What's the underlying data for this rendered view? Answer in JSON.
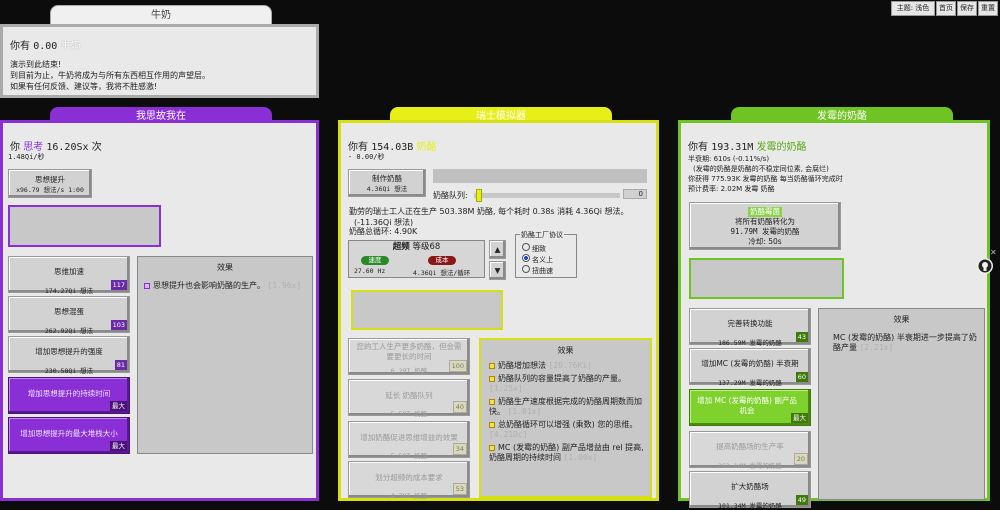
{
  "toolbar": {
    "theme": "主题: 浅色",
    "home": "首页",
    "save": "保存",
    "reset": "重置"
  },
  "milk": {
    "tab": "牛奶",
    "have_prefix": "你有",
    "amount": "0.00",
    "unit": "牛奶",
    "line1": "演示到此结束!",
    "line2": "到目前为止，牛奶将成为与所有东西相互作用的声望层。",
    "line3": "如果有任何反馈、建议等，我将不胜感激!"
  },
  "think": {
    "tab": "我思故我在",
    "have_prefix": "你",
    "unit_label": "思考",
    "amount": "16.20Sx",
    "unit_suffix": "次",
    "rate": "1.48Qi/秒",
    "main_btn_l1": "思想提升",
    "main_btn_l2": "x96.79 想法/s 1:00",
    "upgrades": [
      {
        "name": "思维加速",
        "cost": "174.27Qi 想法",
        "badge": "117"
      },
      {
        "name": "思想混蛋",
        "cost": "262.92Qi 想法",
        "badge": "103"
      },
      {
        "name": "增加思想提升的强度",
        "cost": "230.58Qi 想法",
        "badge": "81"
      },
      {
        "name": "增加思想提升的持续时间",
        "badge": "最大"
      },
      {
        "name": "增加思想提升的最大堆栈大小",
        "badge": "最大"
      }
    ],
    "effect_title": "效果",
    "effect_text": "思想提升也会影响奶酪的生产。",
    "effect_value": "1.96x"
  },
  "swiss": {
    "tab": "瑞士模拟器",
    "have_prefix": "你有",
    "amount": "154.03B",
    "unit": "奶酪",
    "rate": "- 0.00/秒",
    "make_btn_l1": "制作奶酪",
    "make_btn_l2": "4.36Qi 想法",
    "queue_label": "奶酪队列:",
    "queue_count": "0",
    "info1": "勤劳的瑞士工人正在生产 503.38M 奶酪, 每个耗时 0.38s 消耗 4.36Qi 想法。",
    "info2": "(-11.36Qi 想法)",
    "info3": "奶酪总循环: 4.90K",
    "hz_title": "超频",
    "hz_level": "等级68",
    "speed_label": "速度",
    "cost_label": "成本",
    "speed_val": "27.60 Hz",
    "cost_val": "4.36Qi 想法/循环",
    "protocol_title": "奶酪工厂协议",
    "protocols": [
      "细致",
      "名义上",
      "扭曲速"
    ],
    "upgrades": [
      {
        "name": "您的工人生产更多奶酪，但会需要更长的时间",
        "cost": "6.29T 奶酪",
        "badge": "100"
      },
      {
        "name": "延长 奶酪队列",
        "cost": "5.59T 奶酪",
        "badge": "40"
      },
      {
        "name": "增加奶酪促进思维增益的效果",
        "cost": "5.59T 奶酪",
        "badge": "34"
      },
      {
        "name": "划分超频的成本要求",
        "cost": "4.78T 奶酪",
        "badge": "53"
      }
    ],
    "effect_title": "效果",
    "effects": [
      {
        "text": "奶酪增加想法",
        "value": "29.76Ki"
      },
      {
        "text": "奶酪队列的容量提高了奶酪的产量。",
        "value": "1.25x"
      },
      {
        "text": "奶酪生产速度根据完成的奶酪周期数而加快。",
        "value": "1.81x"
      },
      {
        "text": "总奶酪循环可以增强 (乘数) 您的思维。",
        "value": "4.21Dc"
      },
      {
        "text": "MC (发霉的奶酪) 副产品增益由 rel 提高, 奶酪周期的持续时间",
        "value": "1.00x"
      }
    ]
  },
  "moldy": {
    "tab": "发霉的奶酪",
    "have_prefix": "你有",
    "amount": "193.31M",
    "unit": "发霉的奶酪",
    "half_life": "半衰期: 610s (-0.11%/s)",
    "note": "(发霉的奶酪是奶酪的不稳定同位素, 会腐烂)",
    "gain": "你获得 775.93K 发霉的奶酪 每当奶酪循环完成时",
    "expected": "预计费率: 2.02M 发霉 奶酪",
    "convert_title": "奶酪霉菌",
    "convert_l2": "将所有奶酪转化为",
    "convert_l3": "91.79M 发霉的奶酪",
    "convert_l4": "冷却: 50s",
    "upgrades": [
      {
        "name": "完善转换功能",
        "cost": "186.59M 发霉的奶酪",
        "badge": "43"
      },
      {
        "name": "增加MC (发霉的奶酪) 半衰期",
        "cost": "137.29M 发霉的奶酪",
        "badge": "60"
      },
      {
        "name": "增加 MC (发霉的奶酪) 副产品机会",
        "badge": "最大"
      },
      {
        "name": "提高奶酪场的生产率",
        "cost": "262.14M 发霉的奶酪",
        "badge": "20"
      },
      {
        "name": "扩大奶酪场",
        "cost": "101.34M 发霉的奶酪",
        "badge": "49"
      }
    ],
    "effect_title": "效果",
    "effect_text": "MC (发霉的奶酪) 半衰期进一步提高了奶酪产量",
    "effect_value": "2.21x"
  },
  "colors": {
    "purple": "#8a2fd6",
    "yellow": "#e6ef18",
    "green": "#6fc322",
    "panel": "#e9e9e9"
  },
  "icons": [
    "github-icon",
    "close-icon"
  ]
}
